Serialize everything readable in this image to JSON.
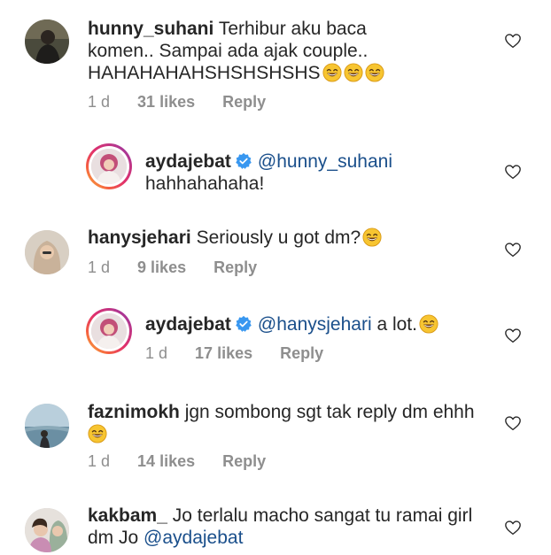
{
  "comments": [
    {
      "username": "hunny_suhani",
      "text_line1": "Terhibur aku baca",
      "text_line2": "komen.. Sampai ada ajak couple..",
      "text_line3": "HAHAHAHAHSHSHSHSHS",
      "time": "1 d",
      "likes": "31 likes",
      "reply": "Reply"
    },
    {
      "username": "aydajebat",
      "mention": "@hunny_suhani",
      "text_line2": "hahhahahaha!"
    },
    {
      "username": "hanysjehari",
      "text": "Seriously u got dm?",
      "time": "1 d",
      "likes": "9 likes",
      "reply": "Reply"
    },
    {
      "username": "aydajebat",
      "mention": "@hanysjehari",
      "text": "a lot.",
      "time": "1 d",
      "likes": "17 likes",
      "reply": "Reply"
    },
    {
      "username": "faznimokh",
      "text": "jgn sombong sgt tak reply dm ehhh",
      "time": "1 d",
      "likes": "14 likes",
      "reply": "Reply"
    },
    {
      "username": "kakbam_",
      "text_line1": "Jo terlalu macho sangat tu ramai girl",
      "text_line2": "dm Jo",
      "mention": "@aydajebat"
    }
  ],
  "icons": {
    "heart": "heart-outline-icon",
    "verified": "verified-badge-icon",
    "emoji": "grinning-face-emoji"
  },
  "colors": {
    "mention": "#1a4f8b",
    "verified": "#3897f0",
    "meta": "#8e8e8e"
  }
}
